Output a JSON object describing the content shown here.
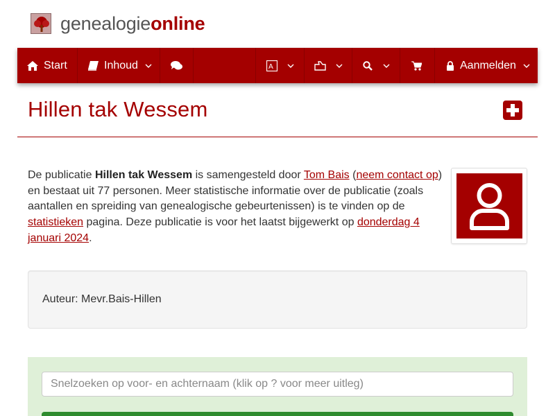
{
  "brand": {
    "name_plain": "genealogie",
    "name_bold": "online"
  },
  "nav": {
    "start": "Start",
    "inhoud": "Inhoud",
    "aanmelden": "Aanmelden",
    "icons": [
      "home-icon",
      "book-icon",
      "comments-icon",
      "language-icon",
      "hand-point-icon",
      "search-icon",
      "shopping-cart-icon",
      "lock-icon"
    ]
  },
  "page": {
    "title": "Hillen tak Wessem"
  },
  "description": {
    "t1": "De publicatie ",
    "publication": "Hillen tak Wessem",
    "t2": " is samengesteld door ",
    "author_link": "Tom Bais",
    "t3": " (",
    "contact_link": "neem contact op",
    "t4": ") en bestaat uit 77 personen. Meer statistische informatie over de publicatie (zoals aantallen en spreiding van genealogische gebeurtenissen) is te vinden op de ",
    "stats_link": "statistieken",
    "t5": " pagina. Deze publicatie is voor het laatst bijgewerkt op ",
    "date_link": "donderdag 4 januari 2024",
    "t6": "."
  },
  "author_box": {
    "text": "Auteur: Mevr.Bais-Hillen"
  },
  "search": {
    "placeholder": "Snelzoeken op voor- en achternaam (klik op ? voor meer uitleg)"
  },
  "colors": {
    "brand": "#a40000",
    "panel_green": "#dff0d8",
    "button_green": "#2e8b2e"
  }
}
